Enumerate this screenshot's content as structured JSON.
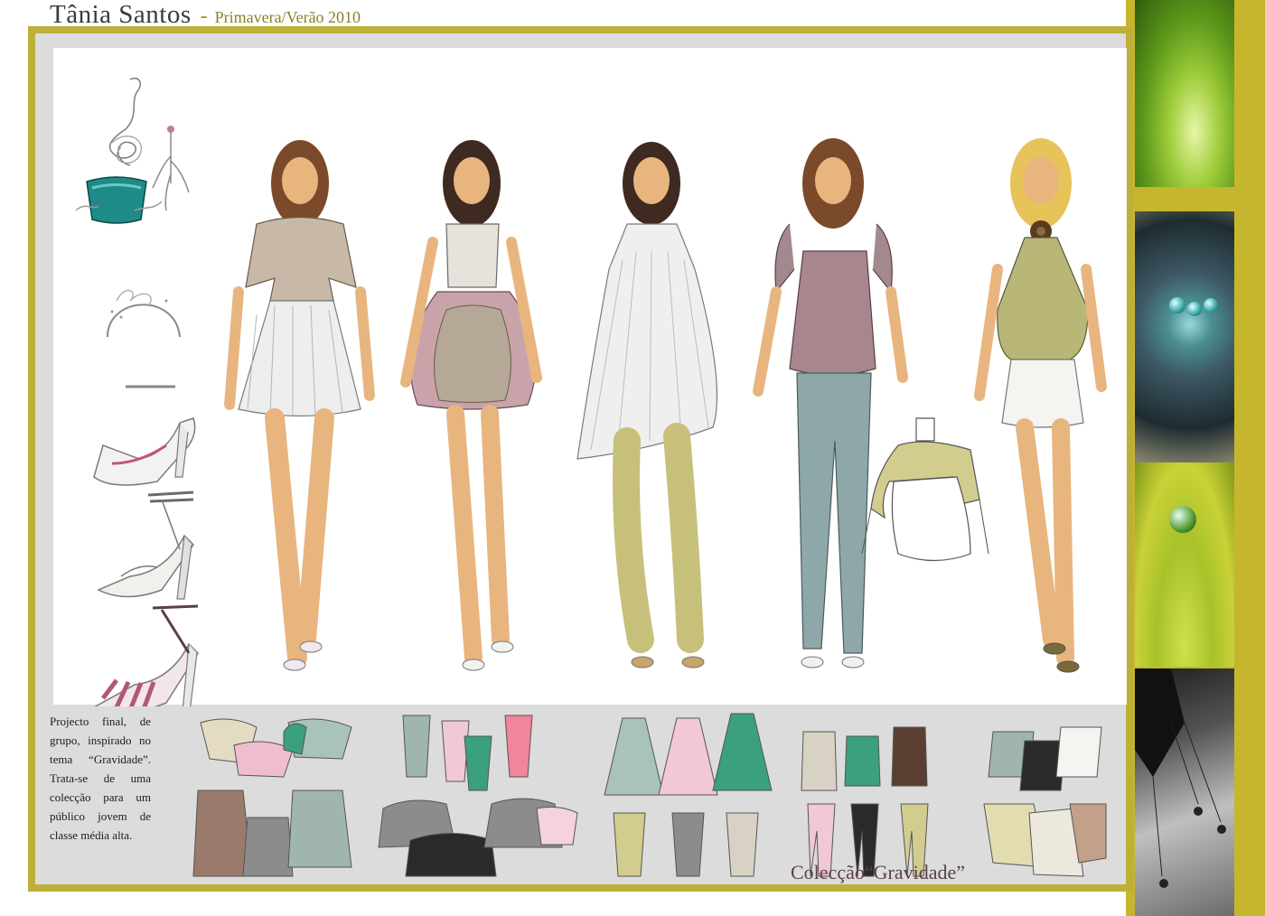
{
  "header": {
    "designer": "Tânia Santos",
    "separator": "-",
    "season": "Primavera/Verão 2010"
  },
  "description": {
    "text": "Projecto final, de grupo, inspirado no tema “Gravidade”. Trata-se de uma colecção para um público jovem de classe média alta."
  },
  "footer": {
    "collection_title": "Colecção“Gravidade”"
  },
  "colors": {
    "frame": "#bdb037",
    "board_bg": "#dcdcdc",
    "strip": "#c6b62e",
    "pink": "#c9a3aa",
    "sage": "#9fb5ad",
    "olive": "#c7c07a",
    "grey": "#8c8c8c",
    "skin": "#e8b57f",
    "denim": "#8ea8a9"
  },
  "accessories": [
    "spiral-earring-icon",
    "feather-earring-icon",
    "teal-ring-icon",
    "headband-icon",
    "white-pink-shoe-icon",
    "strappy-sandal-icon",
    "striped-heel-icon"
  ],
  "looks": [
    "look-1-pleated-dress",
    "look-2-bubble-dress",
    "look-3-pleated-tunic",
    "look-4-top-and-jeans",
    "look-5-halter-top"
  ],
  "flat_groups": [
    "jackets-and-skirts",
    "bodices-and-puff-skirts",
    "long-tunics-and-pants",
    "tops-and-trousers",
    "halter-tops-and-skirts"
  ]
}
